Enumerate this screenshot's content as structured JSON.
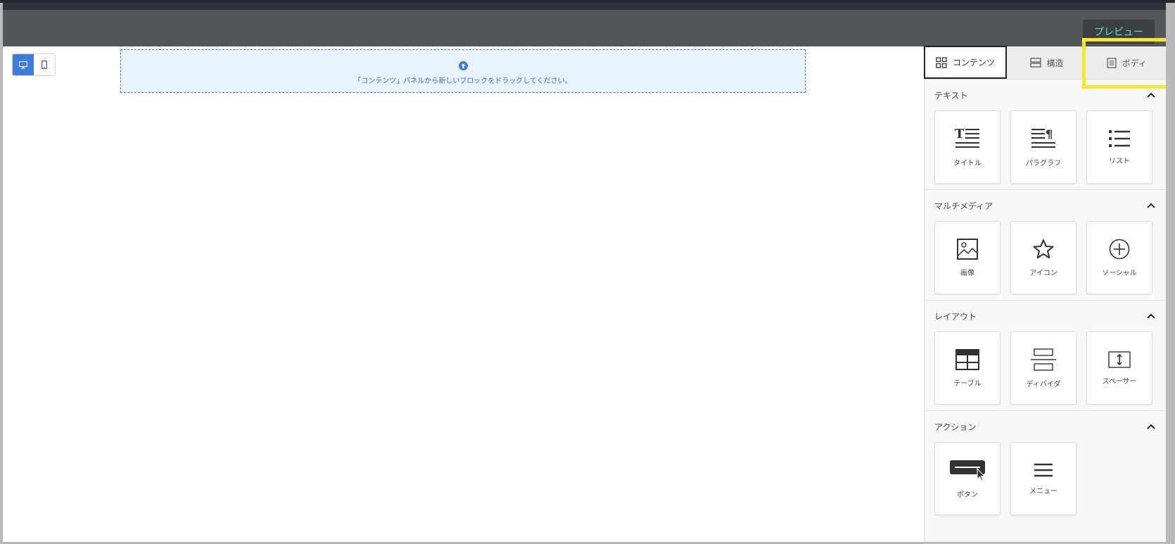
{
  "toolbar": {
    "preview_label": "プレビュー"
  },
  "canvas": {
    "drop_message": "「コンテンツ」パネルから新しいブロックをドラッグしてください。"
  },
  "panel": {
    "tabs": [
      {
        "label": "コンテンツ",
        "icon": "grid-icon"
      },
      {
        "label": "構造",
        "icon": "structure-icon"
      },
      {
        "label": "ボディ",
        "icon": "body-icon"
      }
    ],
    "sections": [
      {
        "title": "テキスト",
        "items": [
          {
            "label": "タイトル"
          },
          {
            "label": "パラグラフ"
          },
          {
            "label": "リスト"
          }
        ]
      },
      {
        "title": "マルチメディア",
        "items": [
          {
            "label": "画像"
          },
          {
            "label": "アイコン"
          },
          {
            "label": "ソーシャル"
          }
        ]
      },
      {
        "title": "レイアウト",
        "items": [
          {
            "label": "テーブル"
          },
          {
            "label": "ディバイダ"
          },
          {
            "label": "スペーサー"
          }
        ]
      },
      {
        "title": "アクション",
        "items": [
          {
            "label": "ボタン"
          },
          {
            "label": "メニュー"
          }
        ]
      }
    ]
  },
  "colors": {
    "accent": "#3b7ddd",
    "highlight": "#f5e72a",
    "preview_text": "#5fd9b8",
    "toolbar": "#52585b"
  }
}
